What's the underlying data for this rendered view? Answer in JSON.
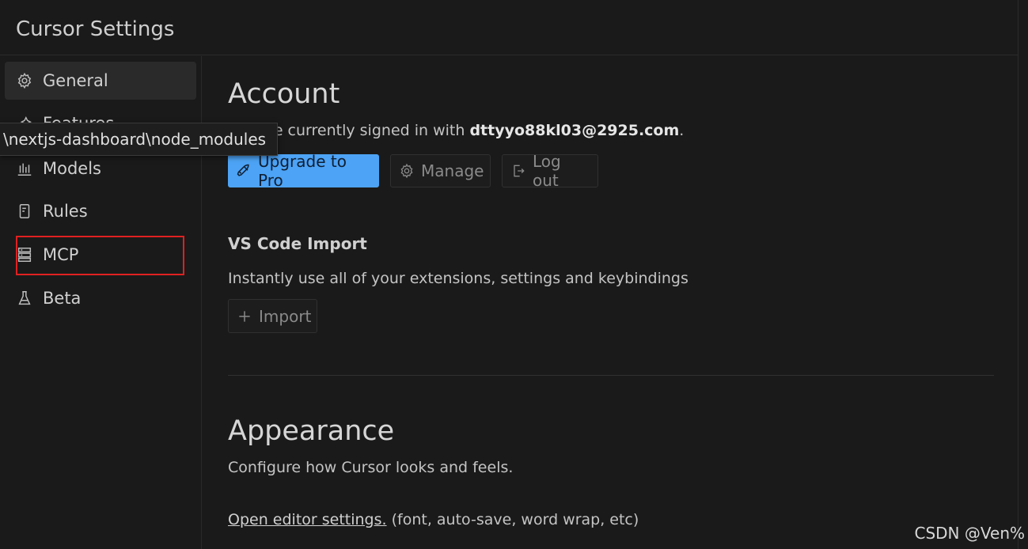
{
  "window": {
    "title": "Cursor Settings"
  },
  "sidebar": {
    "items": [
      {
        "label": "General",
        "icon": "gear-icon",
        "active": true
      },
      {
        "label": "Features",
        "icon": "features-icon",
        "active": false
      },
      {
        "label": "Models",
        "icon": "chart-bars-icon",
        "active": false
      },
      {
        "label": "Rules",
        "icon": "document-icon",
        "active": false
      },
      {
        "label": "MCP",
        "icon": "server-icon",
        "active": false
      },
      {
        "label": "Beta",
        "icon": "flask-icon",
        "active": false
      }
    ]
  },
  "tooltip": {
    "text": "\\nextjs-dashboard\\node_modules"
  },
  "account": {
    "heading": "Account",
    "signed_in_prefix": "You are currently signed in with ",
    "email": "dttyyo88kl03@2925.com",
    "signed_in_suffix": ".",
    "upgrade_label": "Upgrade to Pro",
    "manage_label": "Manage",
    "logout_label": "Log out"
  },
  "vscode_import": {
    "heading": "VS Code Import",
    "description": "Instantly use all of your extensions, settings and keybindings",
    "import_label": "Import"
  },
  "appearance": {
    "heading": "Appearance",
    "description": "Configure how Cursor looks and feels.",
    "editor_link": "Open editor settings.",
    "editor_link_suffix": " (font, auto-save, word wrap, etc)"
  },
  "watermark": "CSDN @Ven%",
  "colors": {
    "accent": "#4da3f5",
    "highlight": "#e02020",
    "background": "#1a1a1a"
  }
}
